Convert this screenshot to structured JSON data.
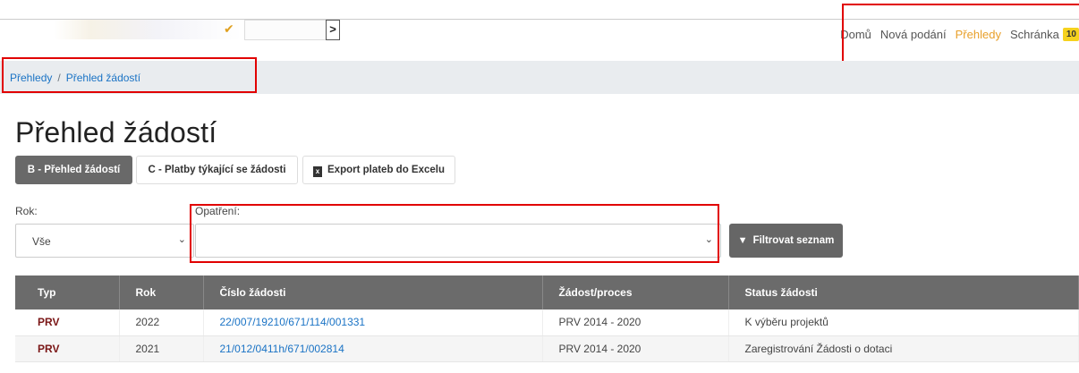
{
  "header": {
    "nav": [
      {
        "label": "Domů",
        "active": false
      },
      {
        "label": "Nová podání",
        "active": false
      },
      {
        "label": "Přehledy",
        "active": true
      },
      {
        "label": "Schránka",
        "active": false
      }
    ],
    "inbox_badge": "10",
    "search_go_glyph": ">",
    "check_glyph": "✔"
  },
  "breadcrumb": {
    "items": [
      "Přehledy",
      "Přehled žádostí"
    ],
    "separator": "/"
  },
  "page_title": "Přehled žádostí",
  "tabs": {
    "b_label": "B - Přehled žádostí",
    "c_label": "C - Platby týkající se žádosti",
    "export_label": "Export plateb do Excelu",
    "export_icon": "excel-icon"
  },
  "filters": {
    "rok_label": "Rok:",
    "rok_value": "Vše",
    "opatreni_label": "Opatření:",
    "opatreni_value": "",
    "filter_button": "Filtrovat seznam",
    "filter_icon": "funnel-icon"
  },
  "table": {
    "columns": [
      "Typ",
      "Rok",
      "Číslo žádosti",
      "Žádost/proces",
      "Status žádosti"
    ],
    "rows": [
      {
        "typ": "PRV",
        "rok": "2022",
        "cislo": "22/007/19210/671/114/001331",
        "proces": "PRV 2014 - 2020",
        "status": "K výběru projektů"
      },
      {
        "typ": "PRV",
        "rok": "2021",
        "cislo": "21/012/0411h/671/002814",
        "proces": "PRV 2014 - 2020",
        "status": "Zaregistrování Žádosti o dotaci"
      }
    ]
  },
  "colors": {
    "accent": "#e8a02b",
    "link": "#1a73c5",
    "highlight": "#e10000",
    "typ_text": "#7a1616",
    "header_bg": "#6b6b6b"
  }
}
